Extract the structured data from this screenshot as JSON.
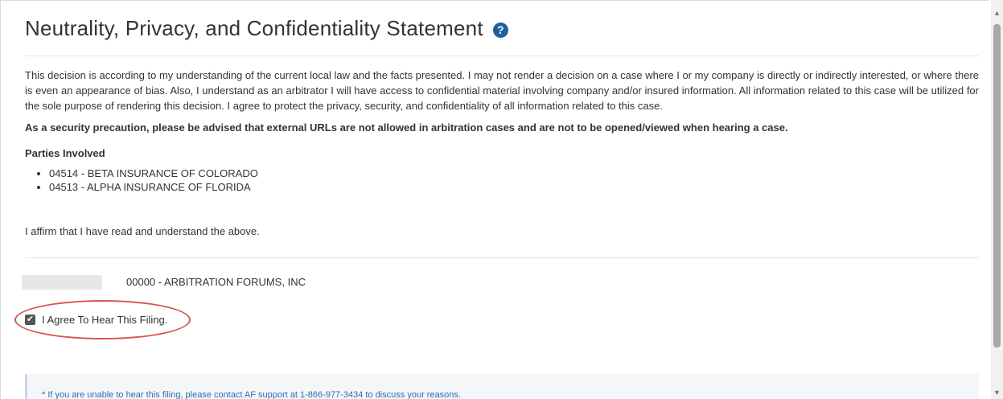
{
  "page": {
    "title": "Neutrality, Privacy, and Confidentiality Statement",
    "help_icon": "question-circle-icon",
    "statement": "This decision is according to my understanding of the current local law and the facts presented. I may not render a decision on a case where I or my company is directly or indirectly interested, or where there is even an appearance of bias. Also, I understand as an arbitrator I will have access to confidential material involving company and/or insured information. All information related to this case will be utilized for the sole purpose of rendering this decision. I agree to protect the privacy, security, and confidentiality of all information related to this case.",
    "security_notice": "As a security precaution, please be advised that external URLs are not allowed in arbitration cases and are not to be opened/viewed when hearing a case.",
    "parties_heading": "Parties Involved",
    "parties": [
      "04514 - BETA INSURANCE OF COLORADO",
      "04513 - ALPHA INSURANCE OF FLORIDA"
    ],
    "affirm_text": "I affirm that I have read and understand the above.",
    "arbitrator_company": "00000 - ARBITRATION FORUMS, INC",
    "agree_checkbox": {
      "label": "I Agree To Hear This Filing.",
      "checked": true
    },
    "support_notice": "* If you are unable to hear this filing, please contact AF support at 1-866-977-3434 to discuss your reasons."
  },
  "colors": {
    "help_icon_bg": "#1f5f9e",
    "highlight_ring": "#d9534f",
    "notice_text": "#2a6db0"
  }
}
